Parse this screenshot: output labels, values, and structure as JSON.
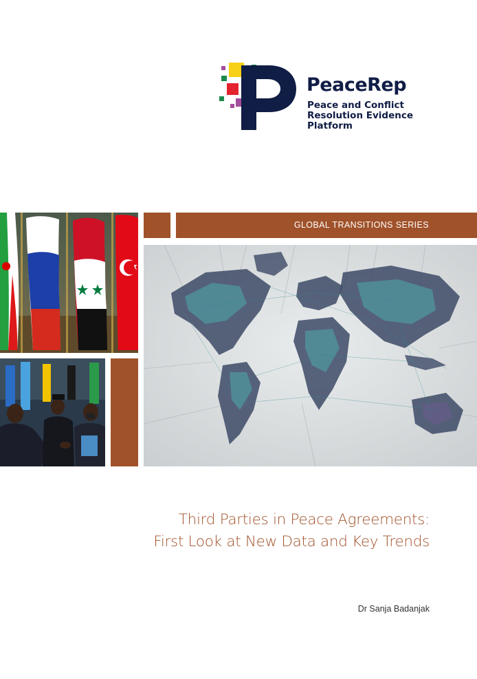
{
  "logo": {
    "name": "PeaceRep",
    "tagline_lines": [
      "Peace and Conflict",
      "Resolution Evidence",
      "Platform"
    ]
  },
  "series": {
    "label": "GLOBAL TRANSITIONS SERIES"
  },
  "images": {
    "flags": "flags-photo",
    "handshake": "handshake-photo",
    "world_map": "network-world-map-photo"
  },
  "document": {
    "title_line_1": "Third Parties in Peace Agreements:",
    "title_line_2": "First Look at New Data and Key Trends",
    "author": "Dr Sanja Badanjak"
  },
  "colors": {
    "accent": "#a0522a",
    "navy": "#101d45",
    "logo_yellow": "#f7d117",
    "logo_red": "#e3232d",
    "logo_purple": "#a54e9d",
    "logo_green": "#1b8a4b"
  }
}
